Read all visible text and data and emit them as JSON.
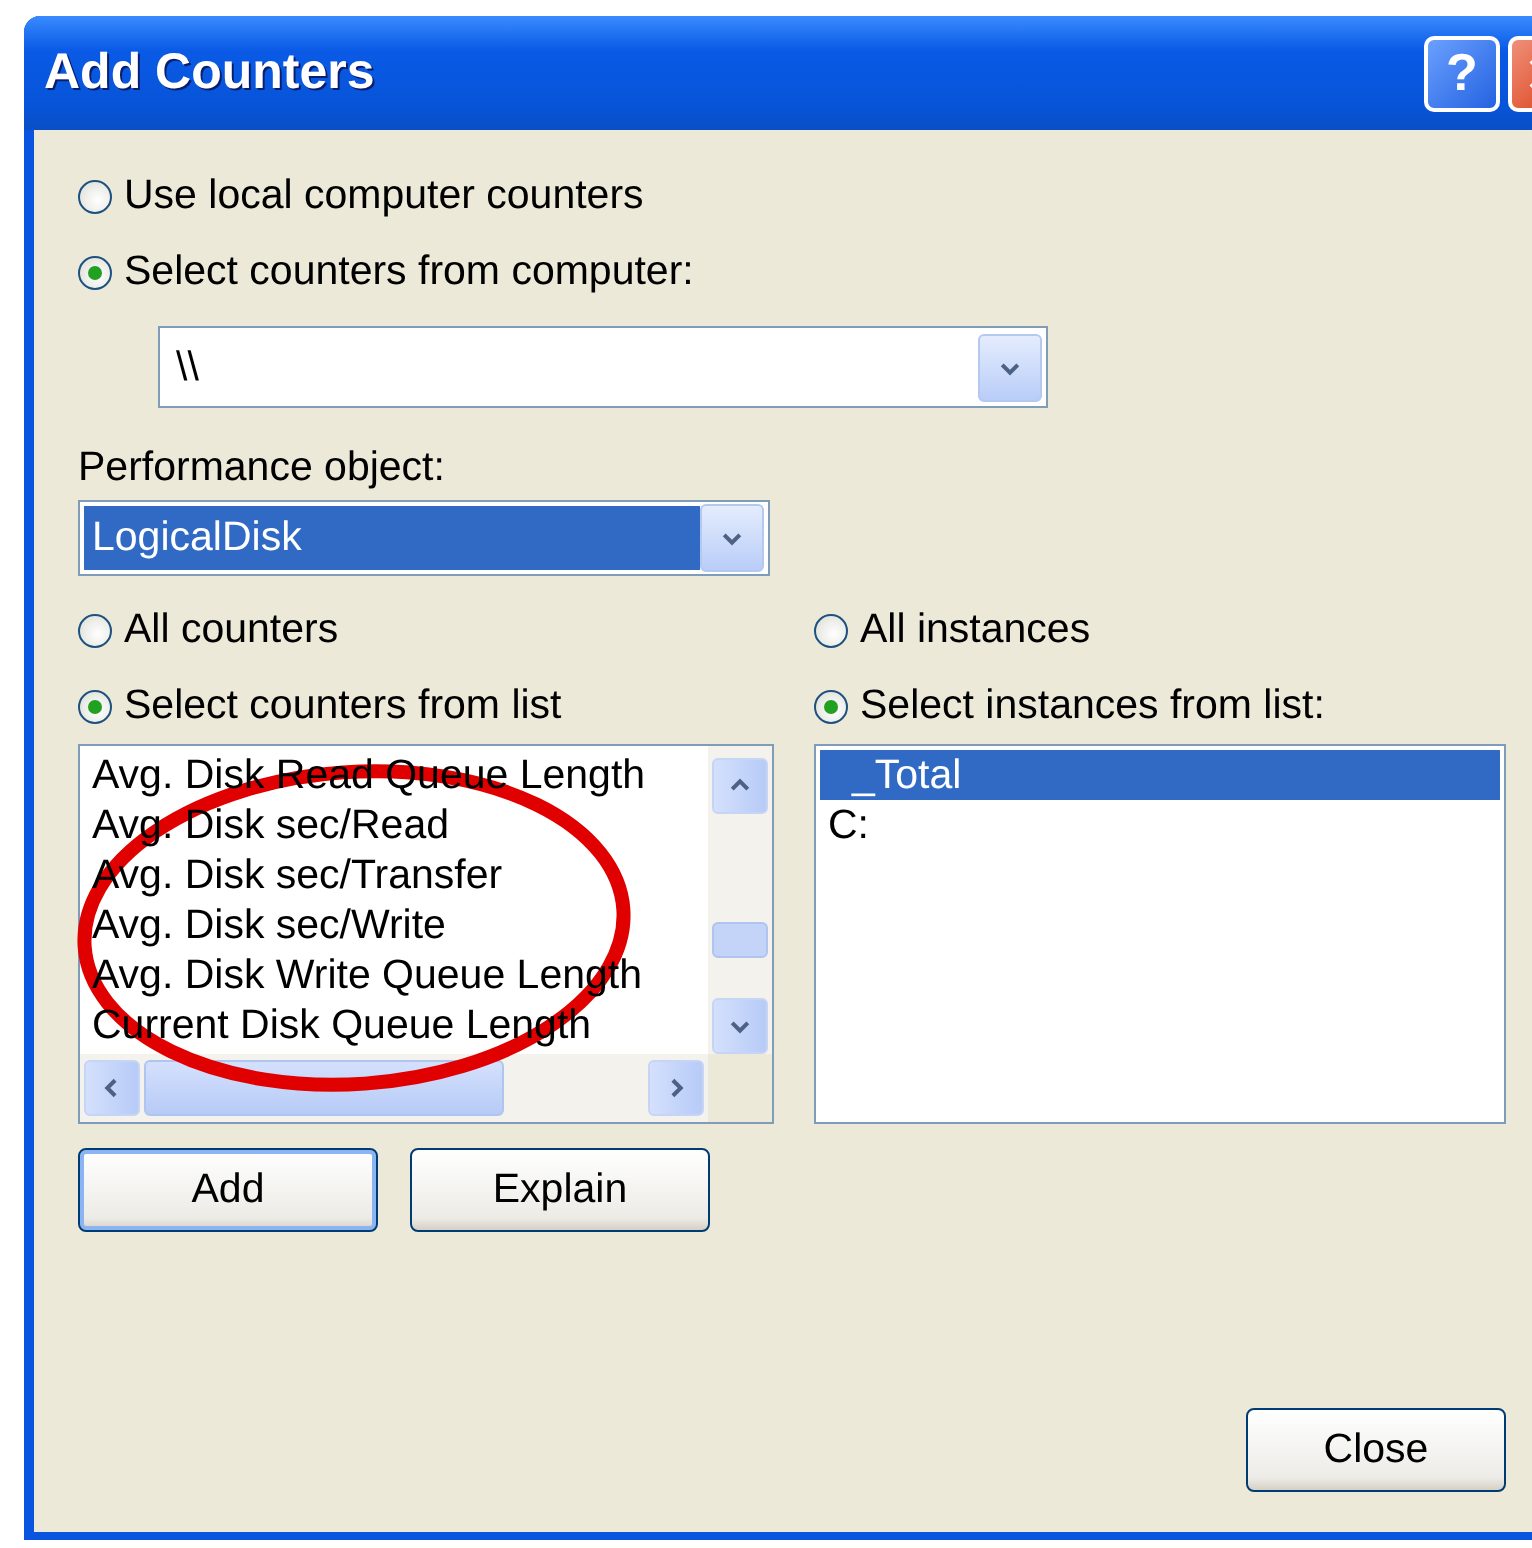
{
  "window": {
    "title": "Add Counters"
  },
  "title_buttons": [
    {
      "kind": "help",
      "label": "?"
    },
    {
      "kind": "close"
    }
  ],
  "source_options": [
    {
      "label": "Use local computer counters",
      "selected": false
    },
    {
      "label": "Select counters from computer:",
      "selected": true
    }
  ],
  "computer_combo": {
    "value": "\\\\"
  },
  "performance_object": {
    "label": "Performance object:",
    "value": "LogicalDisk"
  },
  "counter_options": [
    {
      "label": "All counters",
      "selected": false
    },
    {
      "label": "Select counters from list",
      "selected": true
    }
  ],
  "counters": [
    {
      "label": "Avg. Disk Read Queue Length",
      "selected": false
    },
    {
      "label": "Avg. Disk sec/Read",
      "selected": false
    },
    {
      "label": "Avg. Disk sec/Transfer",
      "selected": false
    },
    {
      "label": "Avg. Disk sec/Write",
      "selected": false
    },
    {
      "label": "Avg. Disk Write Queue Length",
      "selected": false
    },
    {
      "label": "Current Disk Queue Length",
      "selected": false
    }
  ],
  "instance_options": [
    {
      "label": "All instances",
      "selected": false
    },
    {
      "label": "Select instances from list:",
      "selected": true
    }
  ],
  "instances": [
    {
      "label": "_Total",
      "selected": true
    },
    {
      "label": "C:",
      "selected": false
    }
  ],
  "buttons": [
    {
      "label": "Add",
      "focused": true
    },
    {
      "label": "Explain",
      "focused": false
    }
  ],
  "close_button": {
    "label": "Close"
  }
}
